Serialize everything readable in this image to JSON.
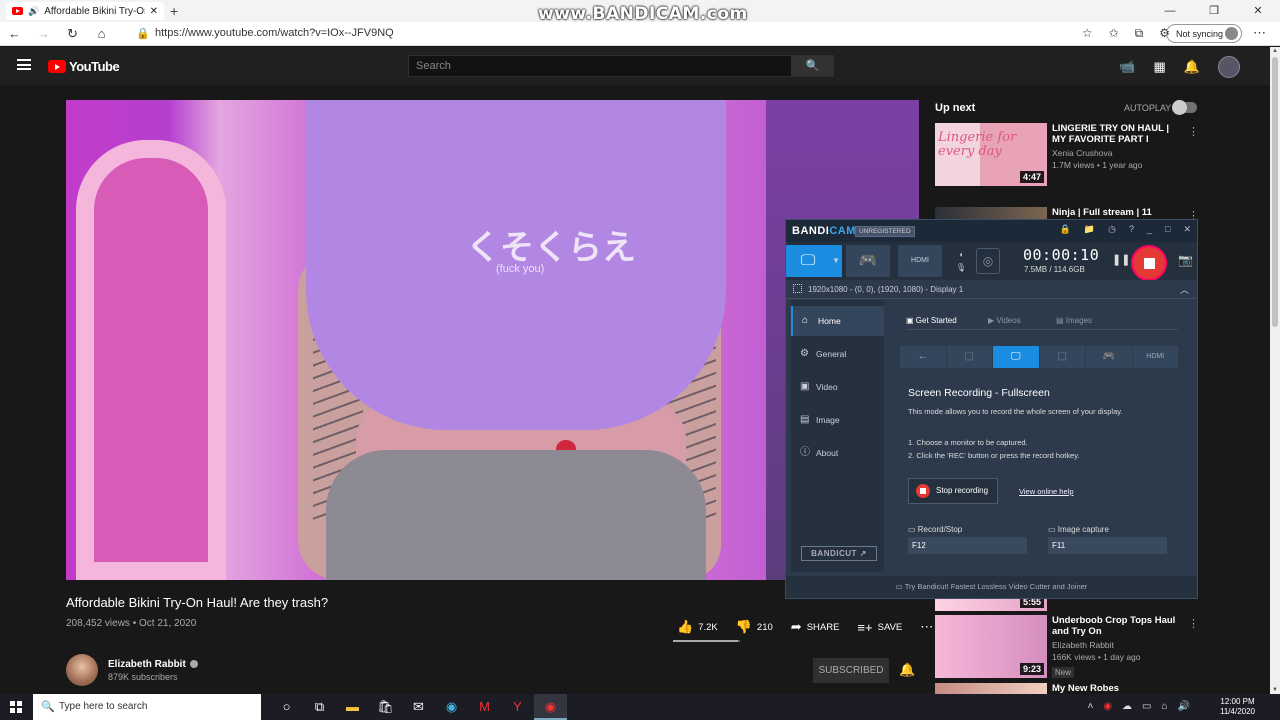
{
  "browser": {
    "tab_title": "Affordable Bikini Try-On Ha",
    "new_tab": "+",
    "url": "https://www.youtube.com/watch?v=IOx--JFV9NQ",
    "sync_label": "Not syncing",
    "window_controls": [
      "—",
      "❐",
      "✕"
    ]
  },
  "watermark": "www.BANDICAM.com",
  "youtube": {
    "logo_text": "YouTube",
    "search_placeholder": "Search",
    "video": {
      "title": "Affordable Bikini Try-On Haul! Are they trash?",
      "meta": "208,452 views • Oct 21, 2020",
      "likes": "7.2K",
      "dislikes": "210",
      "share": "SHARE",
      "save": "SAVE",
      "shirt_text": "くそくらえ",
      "shirt_small": "(fuck you)",
      "like_ratio": 0.97
    },
    "channel": {
      "name": "Elizabeth Rabbit",
      "subscribers": "879K subscribers",
      "subscribe_label": "SUBSCRIBED"
    },
    "upnext": {
      "heading": "Up next",
      "autoplay": "AUTOPLAY",
      "items": [
        {
          "title": "LINGERIE TRY ON HAUL | MY FAVORITE PART I",
          "channel": "Xenia Crushova",
          "views": "1.7M views • 1 year ago",
          "duration": "4:47",
          "thumb_text": "Lingerie for every day"
        },
        {
          "title": "Ninja | Full stream | 11 October",
          "channel": "",
          "views": "",
          "duration": ""
        },
        {
          "title": "",
          "channel": "",
          "views": "",
          "duration": "5:55"
        },
        {
          "title": "Underboob Crop Tops Haul and Try On",
          "channel": "Elizabeth Rabbit",
          "views": "166K views • 1 day ago",
          "duration": "9:23",
          "badge": "New"
        },
        {
          "title": "My New Robes",
          "channel": "",
          "views": "",
          "duration": ""
        }
      ]
    }
  },
  "bandicam": {
    "logo_a": "BANDI",
    "logo_b": "CAM",
    "unregistered": "UNREGISTERED",
    "timer": "00:00:10",
    "size": "7.5MB / 114.6GB",
    "hdmi": "HDMI",
    "region": "1920x1080 - (0, 0), (1920, 1080) - Display 1",
    "nav": [
      "Home",
      "General",
      "Video",
      "Image",
      "About"
    ],
    "tabs": [
      "Get Started",
      "Videos",
      "Images"
    ],
    "heading": "Screen Recording - Fullscreen",
    "desc": "This mode allows you to record the whole screen of your display.",
    "step1": "1. Choose a monitor to be captured.",
    "step2": "2. Click the 'REC' button or press the record hotkey.",
    "stop_label": "Stop recording",
    "help_link": "View online help",
    "hotkey1_label": "Record/Stop",
    "hotkey1_value": "F12",
    "hotkey2_label": "Image capture",
    "hotkey2_value": "F11",
    "bandicut": "BANDICUT ↗",
    "footer": "Try Bandicut! Fastest Lossless Video Cutter and Joiner"
  },
  "taskbar": {
    "search_placeholder": "Type here to search",
    "time": "12:00 PM",
    "date": "11/4/2020"
  }
}
